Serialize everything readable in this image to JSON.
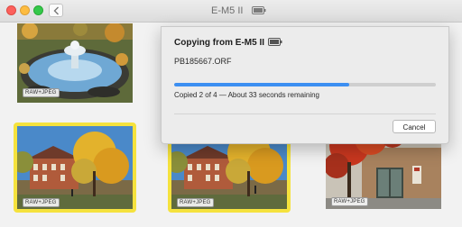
{
  "window": {
    "title": "E-M5 II",
    "icons": [
      "back-chevron-icon",
      "battery-icon"
    ]
  },
  "photos": [
    {
      "badge": "RAW+JPEG",
      "selected": false,
      "subject": "fountain"
    },
    {
      "badge": "RAW+JPEG",
      "selected": true,
      "subject": "building-autumn"
    },
    {
      "badge": "RAW+JPEG",
      "selected": true,
      "subject": "building-autumn"
    },
    {
      "badge": "RAW+JPEG",
      "selected": false,
      "subject": "building-red-tree"
    }
  ],
  "dialog": {
    "title": "Copying from E-M5 II",
    "file_name": "PB185667.ORF",
    "progress_fraction": 0.67,
    "status": "Copied 2 of 4 — About 33 seconds remaining",
    "cancel_label": "Cancel"
  },
  "colors": {
    "selection": "#f5e23d",
    "progress": "#3c8ff2",
    "close": "#fc605c",
    "minimize": "#fdbc40",
    "zoom": "#34c84a"
  }
}
